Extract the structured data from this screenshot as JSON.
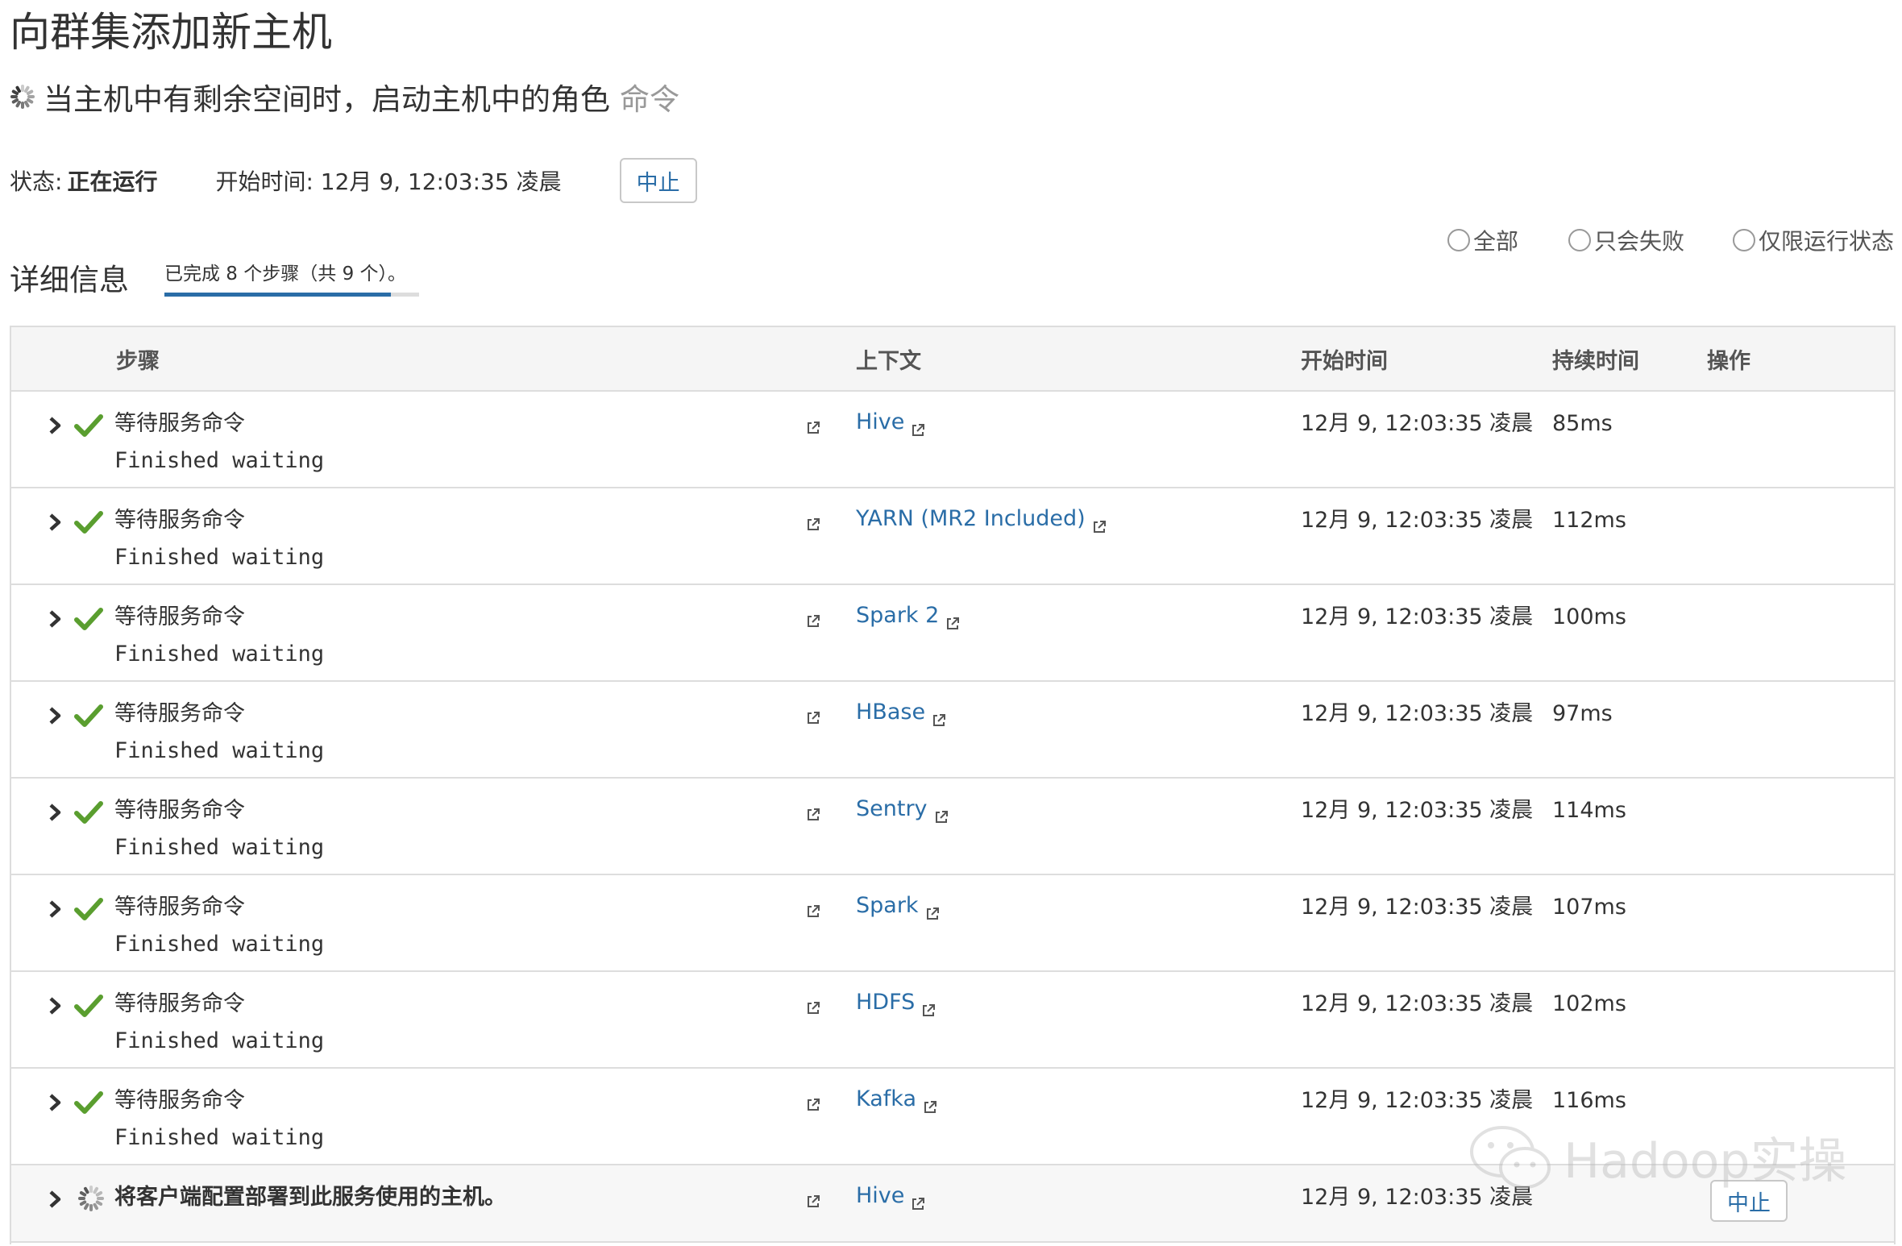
{
  "page": {
    "title": "向群集添加新主机",
    "command_label": "当主机中有剩余空间时，启动主机中的角色",
    "command_suffix": "命令"
  },
  "status": {
    "label": "状态:",
    "value": "正在运行",
    "start_time_label": "开始时间: 12月 9, 12:03:35 凌晨",
    "abort_label": "中止"
  },
  "filters": [
    {
      "label": "全部"
    },
    {
      "label": "只会失败"
    },
    {
      "label": "仅限运行状态"
    }
  ],
  "details": {
    "title": "详细信息",
    "progress_text": "已完成 8 个步骤（共 9 个）。",
    "completed": 8,
    "total": 9
  },
  "table": {
    "headers": {
      "step": "步骤",
      "context": "上下文",
      "start_time": "开始时间",
      "duration": "持续时间",
      "actions": "操作"
    },
    "rows": [
      {
        "step": "等待服务命令",
        "detail": "Finished waiting",
        "context": "Hive",
        "start_time": "12月 9, 12:03:35 凌晨",
        "duration": "85ms",
        "state": "done"
      },
      {
        "step": "等待服务命令",
        "detail": "Finished waiting",
        "context": "YARN (MR2 Included)",
        "start_time": "12月 9, 12:03:35 凌晨",
        "duration": "112ms",
        "state": "done"
      },
      {
        "step": "等待服务命令",
        "detail": "Finished waiting",
        "context": "Spark 2",
        "start_time": "12月 9, 12:03:35 凌晨",
        "duration": "100ms",
        "state": "done"
      },
      {
        "step": "等待服务命令",
        "detail": "Finished waiting",
        "context": "HBase",
        "start_time": "12月 9, 12:03:35 凌晨",
        "duration": "97ms",
        "state": "done"
      },
      {
        "step": "等待服务命令",
        "detail": "Finished waiting",
        "context": "Sentry",
        "start_time": "12月 9, 12:03:35 凌晨",
        "duration": "114ms",
        "state": "done"
      },
      {
        "step": "等待服务命令",
        "detail": "Finished waiting",
        "context": "Spark",
        "start_time": "12月 9, 12:03:35 凌晨",
        "duration": "107ms",
        "state": "done"
      },
      {
        "step": "等待服务命令",
        "detail": "Finished waiting",
        "context": "HDFS",
        "start_time": "12月 9, 12:03:35 凌晨",
        "duration": "102ms",
        "state": "done"
      },
      {
        "step": "等待服务命令",
        "detail": "Finished waiting",
        "context": "Kafka",
        "start_time": "12月 9, 12:03:35 凌晨",
        "duration": "116ms",
        "state": "done"
      },
      {
        "step": "将客户端配置部署到此服务使用的主机。",
        "detail": "",
        "context": "Hive",
        "start_time": "12月 9, 12:03:35 凌晨",
        "duration": "",
        "state": "running",
        "action": "中止"
      }
    ]
  },
  "watermark": {
    "text": "Hadoop实操",
    "icon": "wechat-icon"
  },
  "colors": {
    "link": "#2a6da7",
    "success": "#5a9e2f",
    "border": "#dddddd",
    "header_bg": "#f5f5f5"
  }
}
